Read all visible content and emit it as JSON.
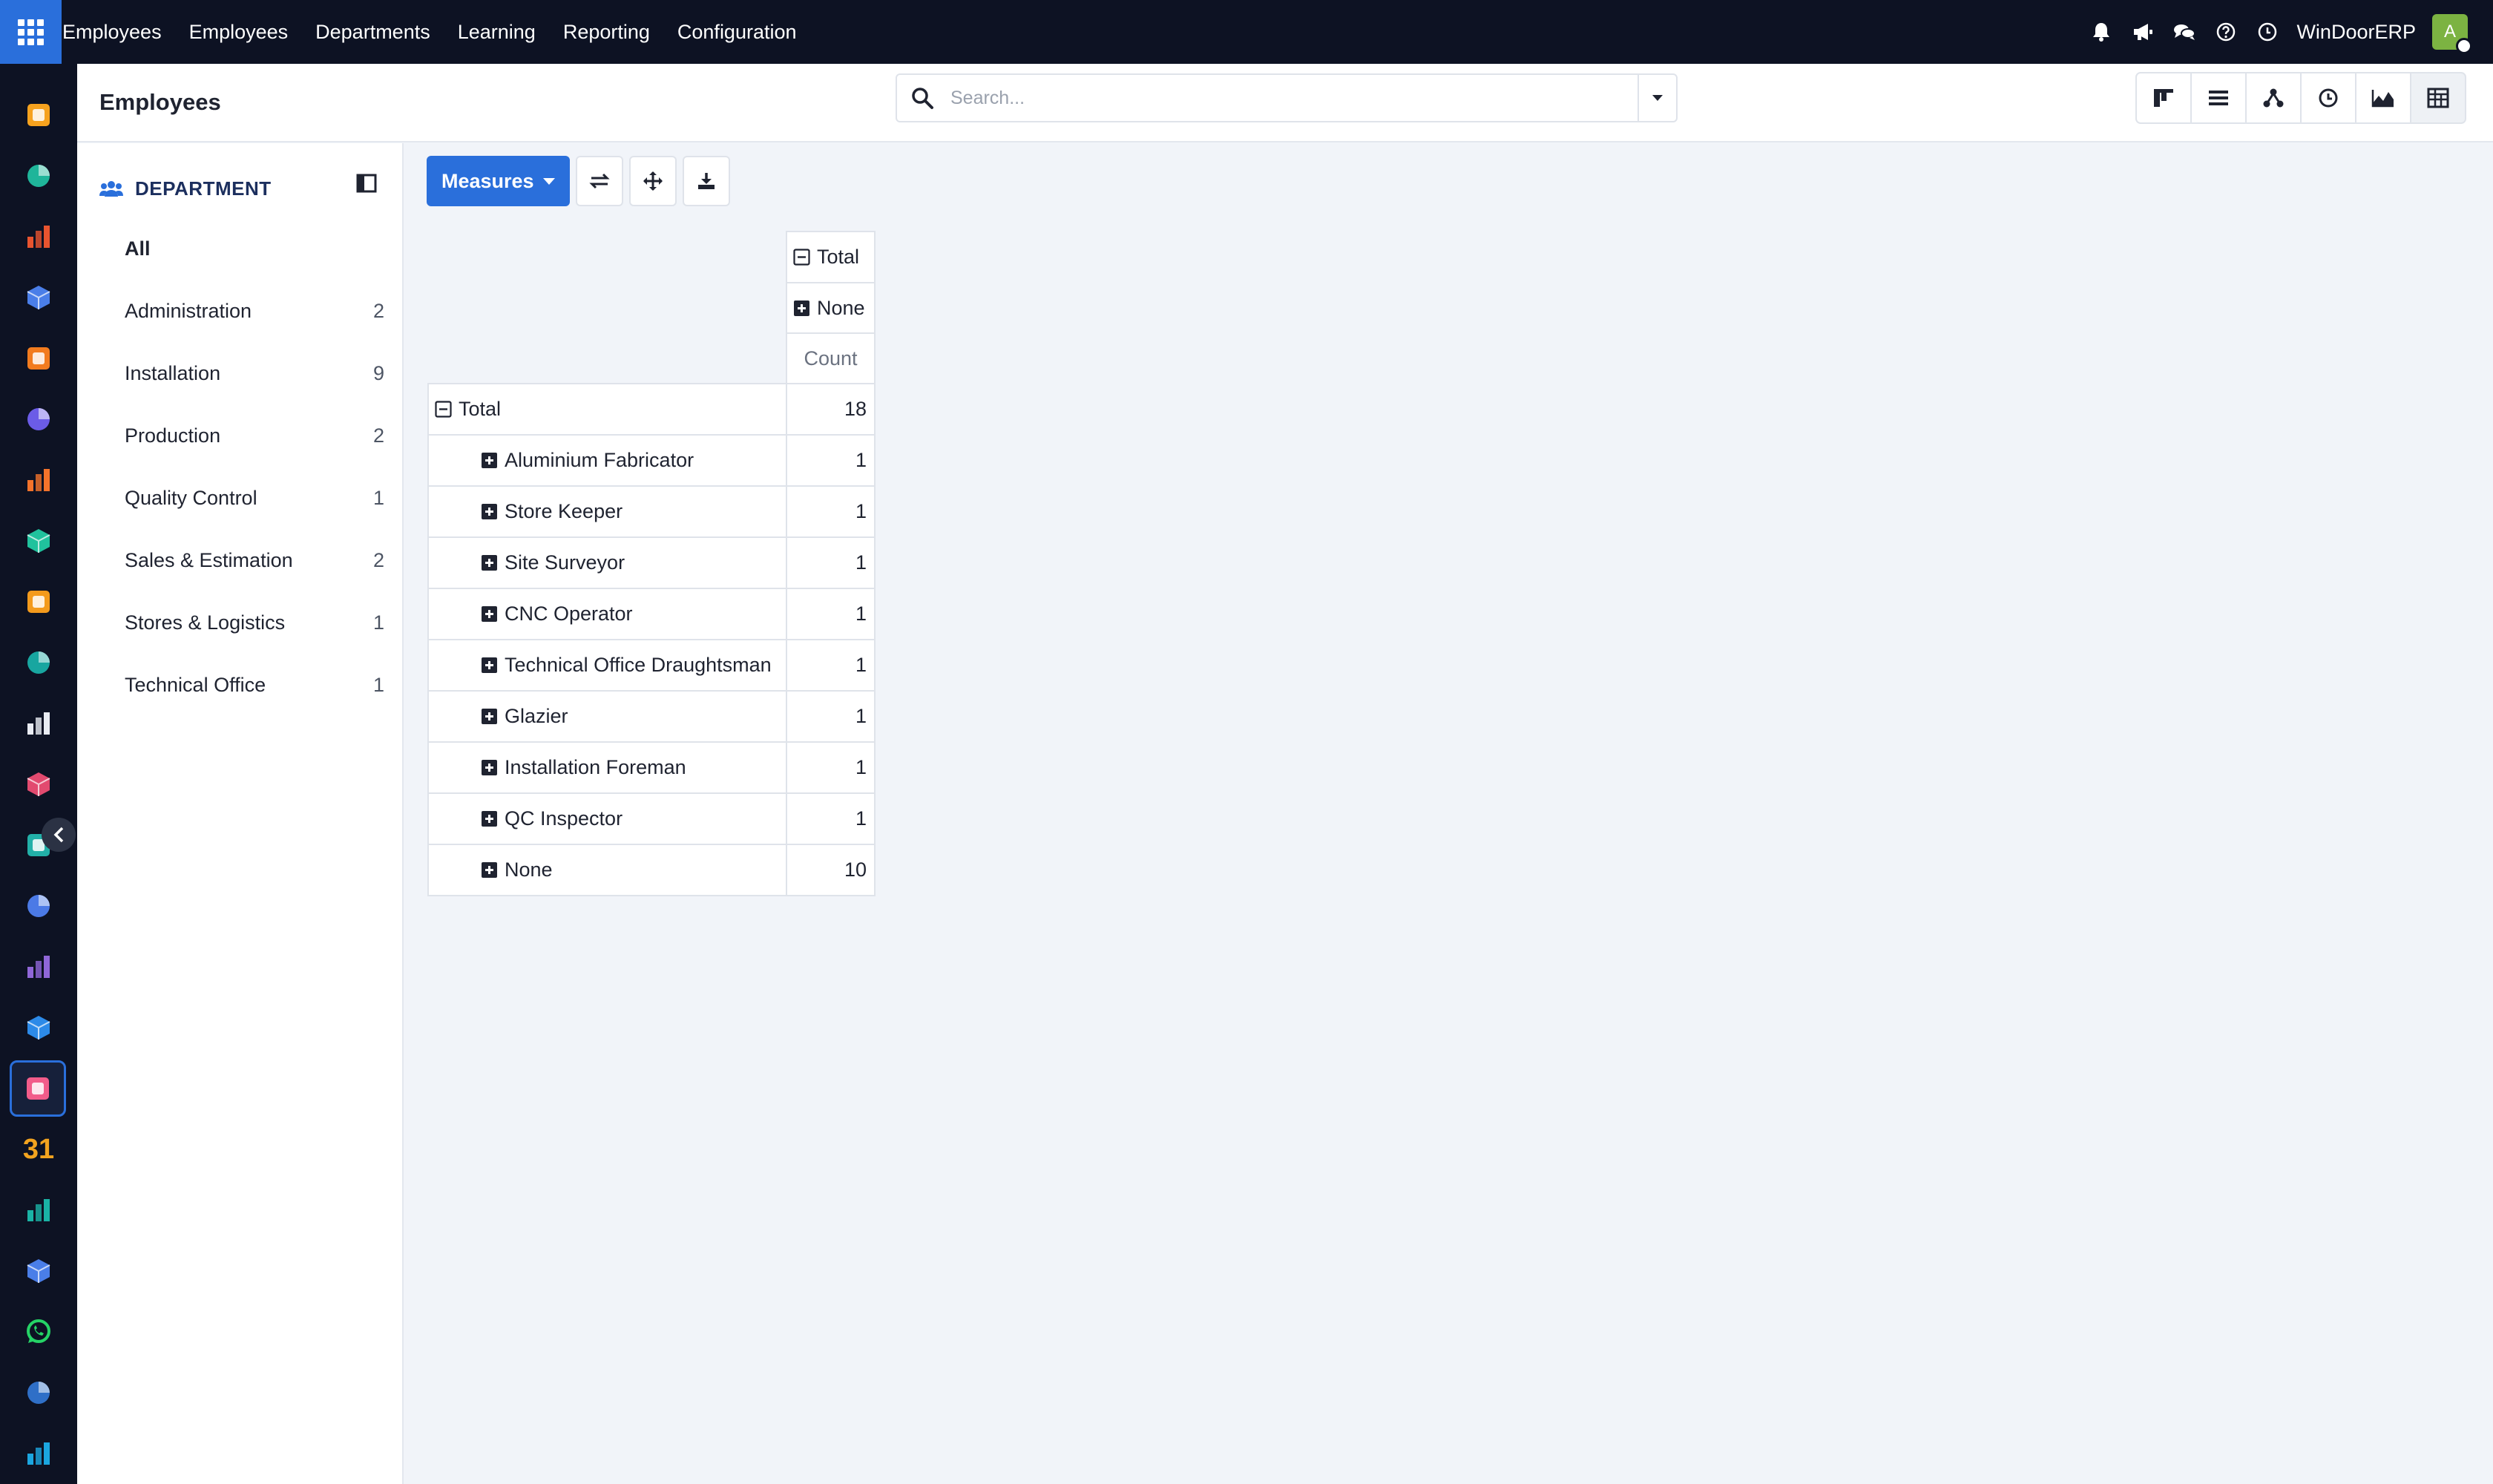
{
  "topbar": {
    "menu": [
      "Employees",
      "Employees",
      "Departments",
      "Learning",
      "Reporting",
      "Configuration"
    ],
    "company": "WinDoorERP",
    "avatar_letter": "A",
    "icons": [
      "bell-icon",
      "megaphone-icon",
      "chat-icon",
      "help-icon",
      "clock-icon"
    ]
  },
  "sidebar": {
    "app_icons": [
      "sales-app-icon",
      "contacts-app-icon",
      "reporting-app-icon",
      "dashboard-app-icon",
      "discuss-app-icon",
      "mail-app-icon",
      "livechat-app-icon",
      "project-app-icon",
      "analytics-app-icon",
      "crm-app-icon",
      "inventory-app-icon",
      "sales2-app-icon",
      "todo-app-icon",
      "knowledge-app-icon",
      "products-app-icon",
      "invoicing-app-icon",
      "employees-app-icon",
      "calendar-app-icon",
      "sign-app-icon",
      "dashboards-app-icon",
      "whatsapp-app-icon",
      "timer-app-icon",
      "website-app-icon"
    ],
    "calendar_day": "31"
  },
  "control": {
    "title": "Employees",
    "search_placeholder": "Search...",
    "views": [
      "kanban-view-icon",
      "list-view-icon",
      "hierarchy-view-icon",
      "activity-view-icon",
      "graph-view-icon",
      "pivot-view-icon"
    ]
  },
  "panel": {
    "header": "DEPARTMENT",
    "items": [
      {
        "label": "All",
        "count": ""
      },
      {
        "label": "Administration",
        "count": "2"
      },
      {
        "label": "Installation",
        "count": "9"
      },
      {
        "label": "Production",
        "count": "2"
      },
      {
        "label": "Quality Control",
        "count": "1"
      },
      {
        "label": "Sales & Estimation",
        "count": "2"
      },
      {
        "label": "Stores & Logistics",
        "count": "1"
      },
      {
        "label": "Technical Office",
        "count": "1"
      }
    ]
  },
  "pivot": {
    "measures_label": "Measures",
    "col_total": "Total",
    "col_none": "None",
    "measure": "Count",
    "row_total_label": "Total",
    "row_total_value": "18",
    "rows": [
      {
        "label": "Aluminium Fabricator",
        "value": "1"
      },
      {
        "label": "Store Keeper",
        "value": "1"
      },
      {
        "label": "Site Surveyor",
        "value": "1"
      },
      {
        "label": "CNC Operator",
        "value": "1"
      },
      {
        "label": "Technical Office Draughtsman",
        "value": "1"
      },
      {
        "label": "Glazier",
        "value": "1"
      },
      {
        "label": "Installation Foreman",
        "value": "1"
      },
      {
        "label": "QC Inspector",
        "value": "1"
      },
      {
        "label": "None",
        "value": "10"
      }
    ]
  },
  "colors": {
    "accent": "#2a6fdb",
    "topbar": "#0d1223",
    "avatar": "#7cb342"
  }
}
